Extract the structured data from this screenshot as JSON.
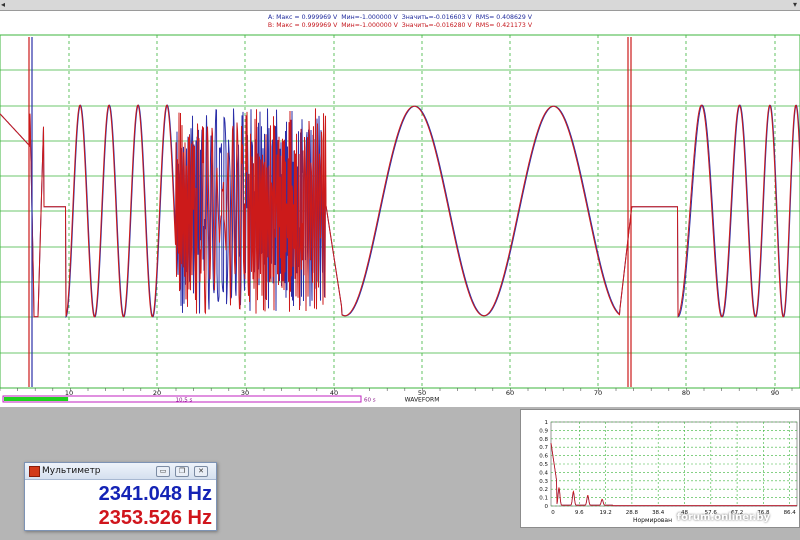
{
  "window": {
    "edge_glyph": "◂",
    "corner_glyph": "▾"
  },
  "channels": {
    "a": {
      "label": "A:",
      "max": "0.999969 V",
      "min": "-1.000000 V",
      "value": "-0.016603 V",
      "rms": "0.408629 V",
      "color": "#1f2a9c"
    },
    "b": {
      "label": "B:",
      "max": "0.999969 V",
      "min": "-1.000000 V",
      "value": "-0.016280 V",
      "rms": "0.421173 V",
      "color": "#c4161c"
    }
  },
  "field_labels": {
    "max": "Макс =",
    "min": "Мин=",
    "value": "Значить=",
    "rms": "RMS="
  },
  "waveform": {
    "x_ticks": [
      "10",
      "20",
      "30",
      "40",
      "50",
      "60",
      "70",
      "80",
      "90"
    ],
    "window_label": "10,5 s",
    "window_end_label": "60 s",
    "title": "WAVEFORM",
    "progress": 0.18
  },
  "spectrum": {
    "y_ticks": [
      "1",
      "0.9",
      "0.8",
      "0.7",
      "0.6",
      "0.5",
      "0.4",
      "0.3",
      "0.2",
      "0.1",
      "0"
    ],
    "x_ticks": [
      "0",
      "9.6",
      "19.2",
      "28.8",
      "38.4",
      "48",
      "57.6",
      "67.2",
      "76.8",
      "86.4"
    ],
    "xlabel": "Нормирован"
  },
  "multimeter": {
    "title": "Мультиметр",
    "value_a": "2341.048 Hz",
    "value_b": "2353.526 Hz",
    "buttons": {
      "minimize": "▭",
      "restore": "❐",
      "close": "✕"
    }
  },
  "watermark": "forum.onliner.by",
  "colors": {
    "grid": "#3cb43c",
    "trace_a": "#2b2fa8",
    "trace_b": "#cc1a1a",
    "progress": "#1ed21e",
    "window": "#c020c0"
  }
}
